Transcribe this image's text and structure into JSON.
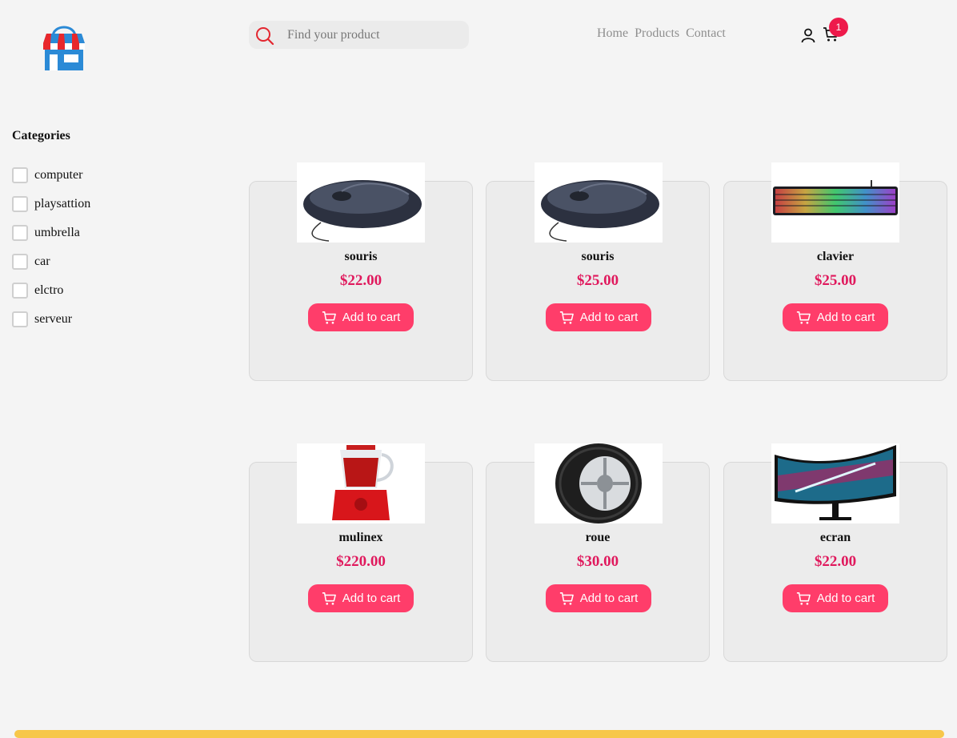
{
  "header": {
    "search": {
      "placeholder": "Find your product",
      "value": ""
    },
    "nav": [
      "Home",
      "Products",
      "Contact"
    ],
    "cart_count": "1"
  },
  "sidebar": {
    "title": "Categories",
    "categories": [
      "computer",
      "playsattion",
      "umbrella",
      "car",
      "elctro",
      "serveur"
    ]
  },
  "products": [
    {
      "name": "souris",
      "price": "$22.00",
      "button": "Add to cart",
      "image": "mouse"
    },
    {
      "name": "souris",
      "price": "$25.00",
      "button": "Add to cart",
      "image": "mouse"
    },
    {
      "name": "clavier",
      "price": "$25.00",
      "button": "Add to cart",
      "image": "keyboard"
    },
    {
      "name": "mulinex",
      "price": "$220.00",
      "button": "Add to cart",
      "image": "blender"
    },
    {
      "name": "roue",
      "price": "$30.00",
      "button": "Add to cart",
      "image": "tire"
    },
    {
      "name": "ecran",
      "price": "$22.00",
      "button": "Add to cart",
      "image": "monitor"
    }
  ],
  "colors": {
    "accent": "#ff3d6a",
    "price": "#e0195d",
    "badge": "#ee1a4b",
    "footer": "#f7c74a"
  }
}
